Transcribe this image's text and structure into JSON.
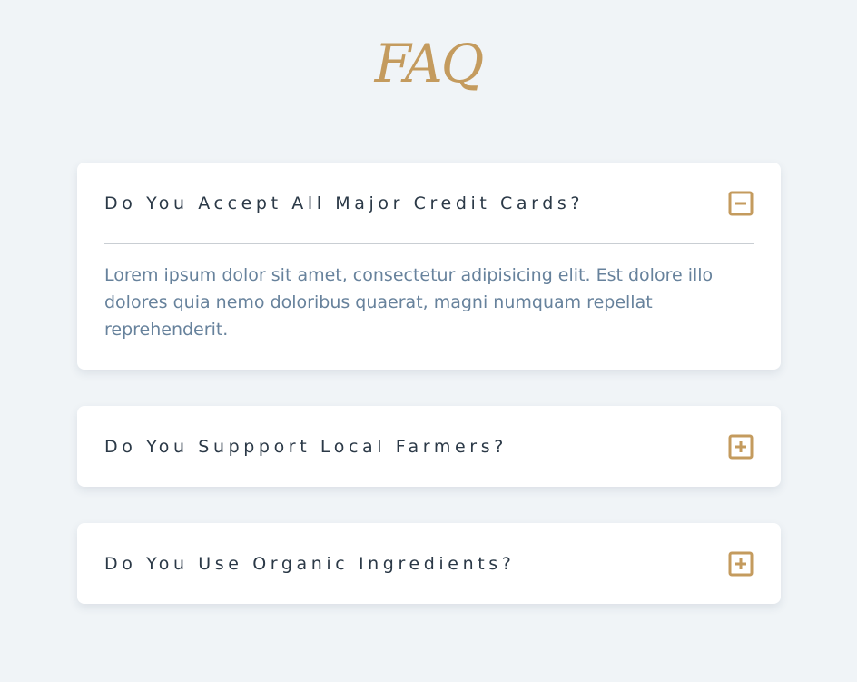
{
  "page": {
    "title": "FAQ"
  },
  "faq": {
    "items": [
      {
        "question": "Do You Accept All Major Credit Cards?",
        "answer": "Lorem ipsum dolor sit amet, consectetur adipisicing elit. Est dolore illo dolores quia nemo doloribus quaerat, magni numquam repellat reprehenderit.",
        "expanded": true,
        "toggle_icon": "minus-square-icon"
      },
      {
        "question": "Do You Suppport Local Farmers?",
        "expanded": false,
        "toggle_icon": "plus-square-icon"
      },
      {
        "question": "Do You Use Organic Ingredients?",
        "expanded": false,
        "toggle_icon": "plus-square-icon"
      }
    ]
  },
  "colors": {
    "background": "#f0f4f7",
    "accent": "#c49b5e",
    "question_text": "#2b3947",
    "answer_text": "#67829c",
    "card": "#ffffff"
  }
}
